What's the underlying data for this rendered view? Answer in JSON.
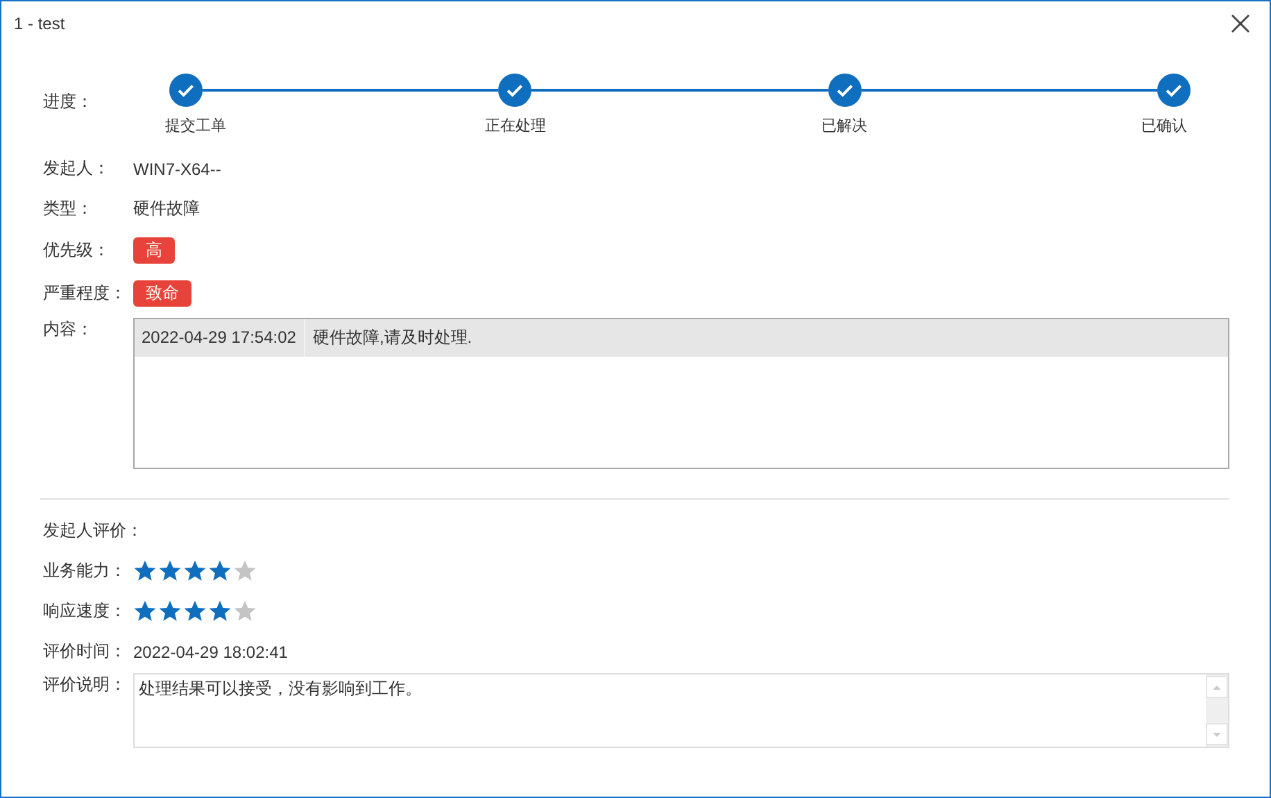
{
  "window": {
    "title": "1 - test"
  },
  "progress": {
    "label": "进度：",
    "steps": [
      {
        "label": "提交工单",
        "done": true
      },
      {
        "label": "正在处理",
        "done": true
      },
      {
        "label": "已解决",
        "done": true
      },
      {
        "label": "已确认",
        "done": true
      }
    ]
  },
  "fields": [
    {
      "kind": "text",
      "label": "发起人：",
      "value": "WIN7-X64--"
    },
    {
      "kind": "text",
      "label": "类型：",
      "value": "硬件故障"
    },
    {
      "kind": "badge",
      "label": "优先级：",
      "value": "高"
    },
    {
      "kind": "badge",
      "label": "严重程度：",
      "value": "致命"
    },
    {
      "kind": "table",
      "label": "内容：",
      "rows": [
        {
          "cells": [
            "2022-04-29 17:54:02",
            "硬件故障,请及时处理."
          ]
        }
      ]
    }
  ],
  "evaluation": {
    "heading": "发起人评价：",
    "ratings": [
      {
        "label": "业务能力：",
        "stars": 4
      },
      {
        "label": "响应速度：",
        "stars": 4
      }
    ],
    "time_label": "评价时间：",
    "time": "2022-04-29 18:02:41",
    "comment_label": "评价说明：",
    "comment": "处理结果可以接受，没有影响到工作。"
  }
}
